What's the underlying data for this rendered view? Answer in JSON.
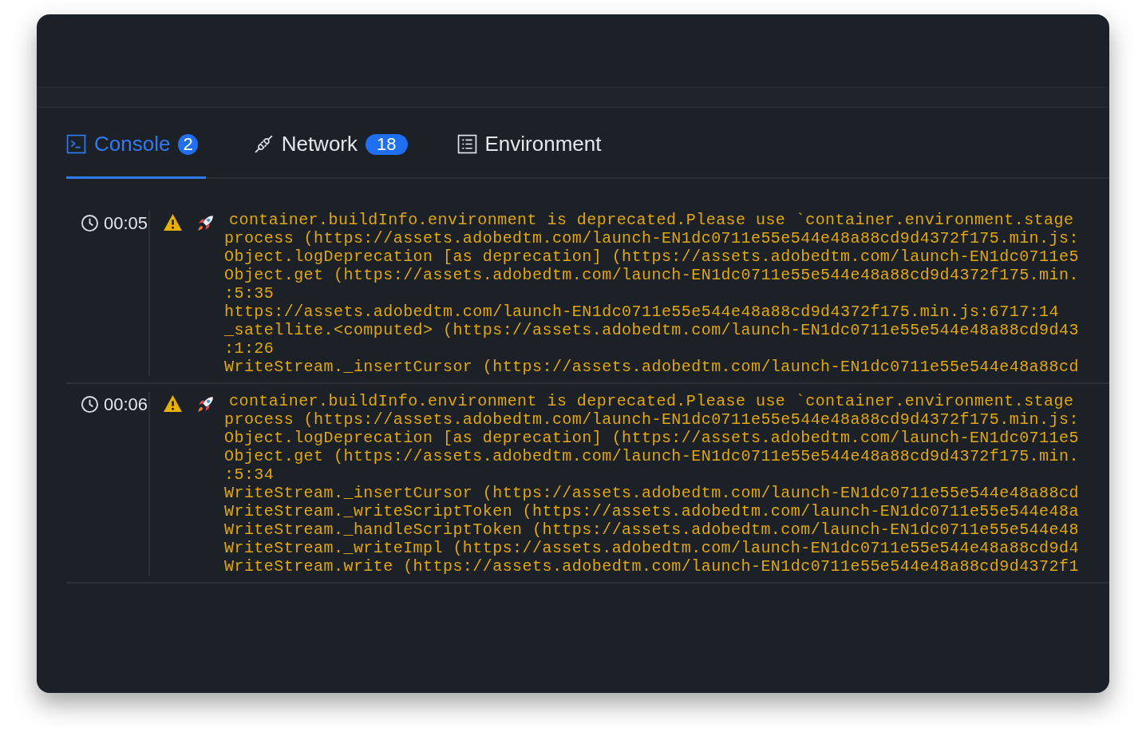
{
  "tabs": [
    {
      "label": "Console",
      "kind": "terminal",
      "badge": "2",
      "selected": true
    },
    {
      "label": "Network",
      "kind": "plug",
      "badge": "18",
      "selected": false
    },
    {
      "label": "Environment",
      "kind": "list",
      "selected": false
    }
  ],
  "logs": [
    {
      "time": "00:05",
      "kind": "warning",
      "lines": [
        "container.buildInfo.environment is deprecated.Please use `container.environment.stage",
        "process (https://assets.adobedtm.com/launch-EN1dc0711e55e544e48a88cd9d4372f175.min.js:",
        "Object.logDeprecation [as deprecation] (https://assets.adobedtm.com/launch-EN1dc0711e5",
        "Object.get (https://assets.adobedtm.com/launch-EN1dc0711e55e544e48a88cd9d4372f175.min.",
        ":5:35",
        "https://assets.adobedtm.com/launch-EN1dc0711e55e544e48a88cd9d4372f175.min.js:6717:14",
        "_satellite.<computed> (https://assets.adobedtm.com/launch-EN1dc0711e55e544e48a88cd9d43",
        ":1:26",
        "WriteStream._insertCursor (https://assets.adobedtm.com/launch-EN1dc0711e55e544e48a88cd"
      ]
    },
    {
      "time": "00:06",
      "kind": "warning",
      "lines": [
        "container.buildInfo.environment is deprecated.Please use `container.environment.stage",
        "process (https://assets.adobedtm.com/launch-EN1dc0711e55e544e48a88cd9d4372f175.min.js:",
        "Object.logDeprecation [as deprecation] (https://assets.adobedtm.com/launch-EN1dc0711e5",
        "Object.get (https://assets.adobedtm.com/launch-EN1dc0711e55e544e48a88cd9d4372f175.min.",
        ":5:34",
        "WriteStream._insertCursor (https://assets.adobedtm.com/launch-EN1dc0711e55e544e48a88cd",
        "WriteStream._writeScriptToken (https://assets.adobedtm.com/launch-EN1dc0711e55e544e48a",
        "WriteStream._handleScriptToken (https://assets.adobedtm.com/launch-EN1dc0711e55e544e48",
        "WriteStream._writeImpl (https://assets.adobedtm.com/launch-EN1dc0711e55e544e48a88cd9d4",
        "WriteStream.write (https://assets.adobedtm.com/launch-EN1dc0711e55e544e48a88cd9d4372f1"
      ]
    }
  ]
}
